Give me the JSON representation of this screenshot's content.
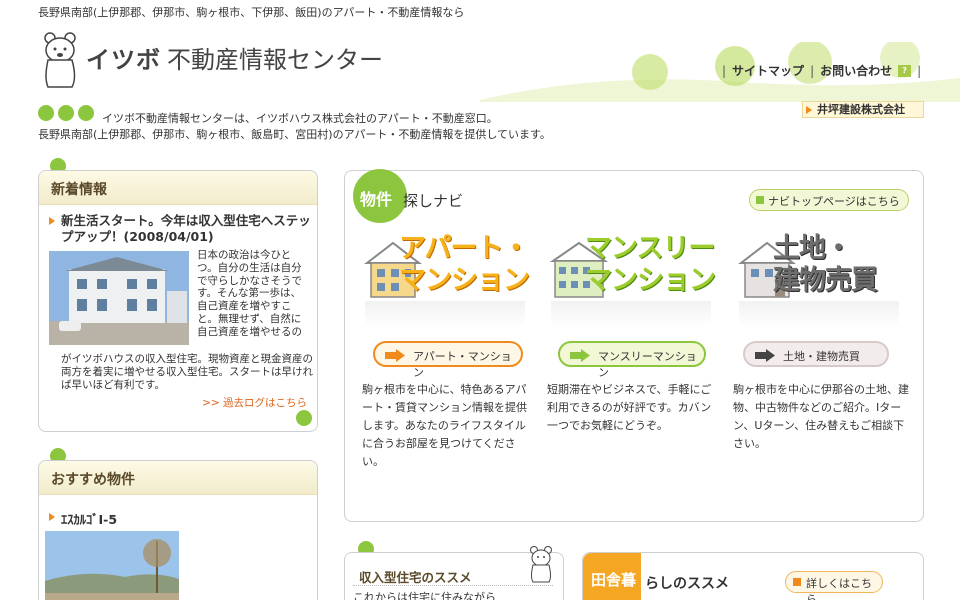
{
  "header": {
    "tagline": "長野県南部(上伊那郡、伊那市、駒ヶ根市、下伊那、飯田)のアパート・不動産情報なら",
    "logo_brand": "イツボ",
    "logo_rest": "不動産情報センター",
    "nav": {
      "sitemap": "サイトマップ",
      "contact": "お問い合わせ",
      "contact_badge": "?"
    },
    "partner": "井坪建設株式会社",
    "intro_line1": "イツボ不動産情報センターは、イツボハウス株式会社のアパート・不動産窓口。",
    "intro_line2": "長野県南部(上伊那郡、伊那市、駒ヶ根市、飯島町、宮田村)のアパート・不動産情報を提供しています。"
  },
  "news": {
    "heading": "新着情報",
    "title": "新生活スタート。今年は収入型住宅へステップアップ！(2008/04/01)",
    "body_side": "日本の政治は今ひとつ。自分の生活は自分で守らしかなさそうです。そんな第一歩は、自己資産を増やすこと。無理せず、自然に自己資産を増やせるの",
    "body_bottom": "がイツボハウスの収入型住宅。現物資産と現金資産の両方を着実に増やせる収入型住宅。スタートは早ければ早いほど有利です。",
    "archive_link": ">> 過去ログはこちら"
  },
  "recommend": {
    "heading": "おすすめ物件",
    "item_title": "ｴｽｶﾙｺﾞⅠ-5"
  },
  "navi": {
    "tab": "物件",
    "subtitle": "探しナビ",
    "top_button": "ナビトップページはこちら",
    "categories": [
      {
        "headline_1": "アパート・",
        "headline_2": "マンション",
        "button": "アパート・マンション",
        "description": "駒ヶ根市を中心に、特色あるアパート・賃貸マンション情報を提供します。あなたのライフスタイルに合うお部屋を見つけてください。"
      },
      {
        "headline_1": "マンスリー",
        "headline_2": "マンション",
        "button": "マンスリーマンション",
        "description": "短期滞在やビジネスで、手軽にご利用できるのが好評です。カバン一つでお気軽にどうぞ。"
      },
      {
        "headline_1": "土地・",
        "headline_2": "建物売買",
        "button": "土地・建物売買",
        "description": "駒ヶ根市を中心に伊那谷の土地、建物、中古物件などのご紹介。Iターン、Uターン、住み替えもご相談下さい。"
      }
    ]
  },
  "income": {
    "title": "収入型住宅のススメ",
    "subtitle": "これからは住宅に住みながら"
  },
  "inaka": {
    "tab": "田舎暮",
    "subtitle": "らしのススメ",
    "button": "詳しくはこちら"
  },
  "colors": {
    "accent_green": "#8cc63f",
    "accent_orange": "#f08a1c",
    "panel_head": "#f2eccc"
  }
}
